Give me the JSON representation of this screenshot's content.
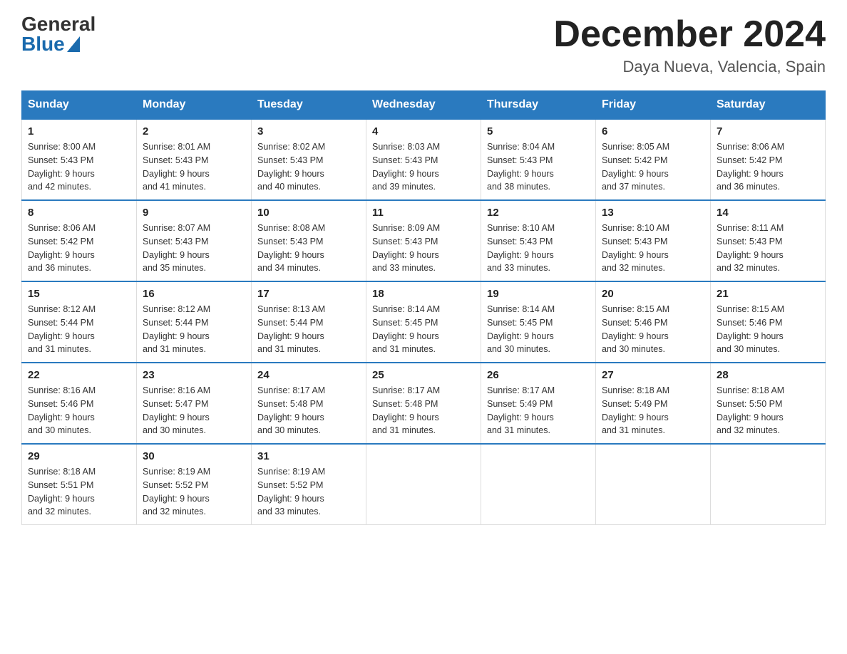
{
  "header": {
    "logo_general": "General",
    "logo_blue": "Blue",
    "title": "December 2024",
    "location": "Daya Nueva, Valencia, Spain"
  },
  "days_of_week": [
    "Sunday",
    "Monday",
    "Tuesday",
    "Wednesday",
    "Thursday",
    "Friday",
    "Saturday"
  ],
  "weeks": [
    [
      {
        "day": "1",
        "sunrise": "8:00 AM",
        "sunset": "5:43 PM",
        "daylight": "9 hours and 42 minutes."
      },
      {
        "day": "2",
        "sunrise": "8:01 AM",
        "sunset": "5:43 PM",
        "daylight": "9 hours and 41 minutes."
      },
      {
        "day": "3",
        "sunrise": "8:02 AM",
        "sunset": "5:43 PM",
        "daylight": "9 hours and 40 minutes."
      },
      {
        "day": "4",
        "sunrise": "8:03 AM",
        "sunset": "5:43 PM",
        "daylight": "9 hours and 39 minutes."
      },
      {
        "day": "5",
        "sunrise": "8:04 AM",
        "sunset": "5:43 PM",
        "daylight": "9 hours and 38 minutes."
      },
      {
        "day": "6",
        "sunrise": "8:05 AM",
        "sunset": "5:42 PM",
        "daylight": "9 hours and 37 minutes."
      },
      {
        "day": "7",
        "sunrise": "8:06 AM",
        "sunset": "5:42 PM",
        "daylight": "9 hours and 36 minutes."
      }
    ],
    [
      {
        "day": "8",
        "sunrise": "8:06 AM",
        "sunset": "5:42 PM",
        "daylight": "9 hours and 36 minutes."
      },
      {
        "day": "9",
        "sunrise": "8:07 AM",
        "sunset": "5:43 PM",
        "daylight": "9 hours and 35 minutes."
      },
      {
        "day": "10",
        "sunrise": "8:08 AM",
        "sunset": "5:43 PM",
        "daylight": "9 hours and 34 minutes."
      },
      {
        "day": "11",
        "sunrise": "8:09 AM",
        "sunset": "5:43 PM",
        "daylight": "9 hours and 33 minutes."
      },
      {
        "day": "12",
        "sunrise": "8:10 AM",
        "sunset": "5:43 PM",
        "daylight": "9 hours and 33 minutes."
      },
      {
        "day": "13",
        "sunrise": "8:10 AM",
        "sunset": "5:43 PM",
        "daylight": "9 hours and 32 minutes."
      },
      {
        "day": "14",
        "sunrise": "8:11 AM",
        "sunset": "5:43 PM",
        "daylight": "9 hours and 32 minutes."
      }
    ],
    [
      {
        "day": "15",
        "sunrise": "8:12 AM",
        "sunset": "5:44 PM",
        "daylight": "9 hours and 31 minutes."
      },
      {
        "day": "16",
        "sunrise": "8:12 AM",
        "sunset": "5:44 PM",
        "daylight": "9 hours and 31 minutes."
      },
      {
        "day": "17",
        "sunrise": "8:13 AM",
        "sunset": "5:44 PM",
        "daylight": "9 hours and 31 minutes."
      },
      {
        "day": "18",
        "sunrise": "8:14 AM",
        "sunset": "5:45 PM",
        "daylight": "9 hours and 31 minutes."
      },
      {
        "day": "19",
        "sunrise": "8:14 AM",
        "sunset": "5:45 PM",
        "daylight": "9 hours and 30 minutes."
      },
      {
        "day": "20",
        "sunrise": "8:15 AM",
        "sunset": "5:46 PM",
        "daylight": "9 hours and 30 minutes."
      },
      {
        "day": "21",
        "sunrise": "8:15 AM",
        "sunset": "5:46 PM",
        "daylight": "9 hours and 30 minutes."
      }
    ],
    [
      {
        "day": "22",
        "sunrise": "8:16 AM",
        "sunset": "5:46 PM",
        "daylight": "9 hours and 30 minutes."
      },
      {
        "day": "23",
        "sunrise": "8:16 AM",
        "sunset": "5:47 PM",
        "daylight": "9 hours and 30 minutes."
      },
      {
        "day": "24",
        "sunrise": "8:17 AM",
        "sunset": "5:48 PM",
        "daylight": "9 hours and 30 minutes."
      },
      {
        "day": "25",
        "sunrise": "8:17 AM",
        "sunset": "5:48 PM",
        "daylight": "9 hours and 31 minutes."
      },
      {
        "day": "26",
        "sunrise": "8:17 AM",
        "sunset": "5:49 PM",
        "daylight": "9 hours and 31 minutes."
      },
      {
        "day": "27",
        "sunrise": "8:18 AM",
        "sunset": "5:49 PM",
        "daylight": "9 hours and 31 minutes."
      },
      {
        "day": "28",
        "sunrise": "8:18 AM",
        "sunset": "5:50 PM",
        "daylight": "9 hours and 32 minutes."
      }
    ],
    [
      {
        "day": "29",
        "sunrise": "8:18 AM",
        "sunset": "5:51 PM",
        "daylight": "9 hours and 32 minutes."
      },
      {
        "day": "30",
        "sunrise": "8:19 AM",
        "sunset": "5:52 PM",
        "daylight": "9 hours and 32 minutes."
      },
      {
        "day": "31",
        "sunrise": "8:19 AM",
        "sunset": "5:52 PM",
        "daylight": "9 hours and 33 minutes."
      },
      null,
      null,
      null,
      null
    ]
  ],
  "labels": {
    "sunrise": "Sunrise:",
    "sunset": "Sunset:",
    "daylight": "Daylight:"
  }
}
